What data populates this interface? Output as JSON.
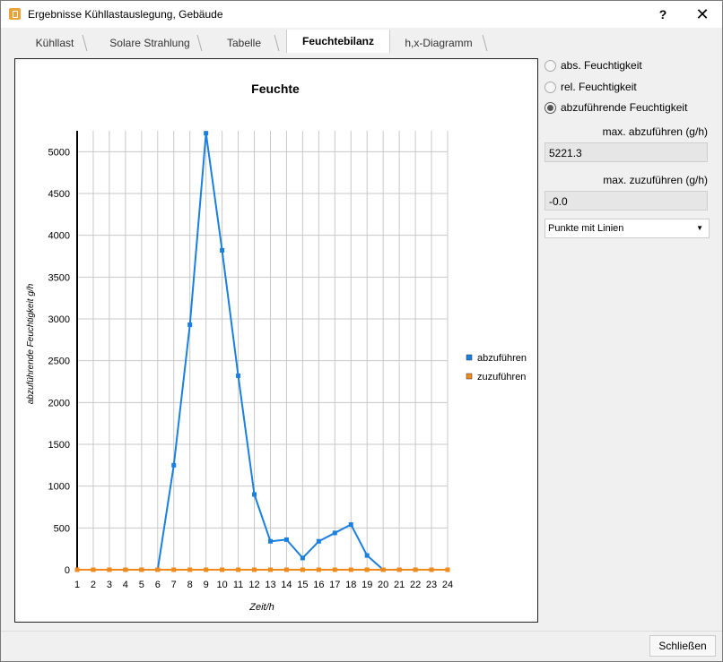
{
  "window": {
    "title": "Ergebnisse Kühllastauslegung, Gebäude",
    "help_label": "?",
    "close_label": "✕"
  },
  "tabs": [
    {
      "label": "Kühllast",
      "active": false
    },
    {
      "label": "Solare Strahlung",
      "active": false
    },
    {
      "label": "Tabelle",
      "active": false
    },
    {
      "label": "Feuchtebilanz",
      "active": true
    },
    {
      "label": "h,x-Diagramm",
      "active": false
    }
  ],
  "side_panel": {
    "radio_abs": "abs. Feuchtigkeit",
    "radio_rel": "rel. Feuchtigkeit",
    "radio_abzu": "abzuführende Feuchtigkeit",
    "max_abzufuehren_label": "max. abzuführen (g/h)",
    "max_abzufuehren_value": "5221.3",
    "max_zuzufuehren_label": "max. zuzuführen (g/h)",
    "max_zuzufuehren_value": "-0.0",
    "display_mode": "Punkte mit Linien"
  },
  "footer": {
    "close_button": "Schließen"
  },
  "chart_data": {
    "type": "line",
    "title": "Feuchte",
    "xlabel": "Zeit/h",
    "ylabel": "abzuführende Feuchtigkeit g/h",
    "x": [
      1,
      2,
      3,
      4,
      5,
      6,
      7,
      8,
      9,
      10,
      11,
      12,
      13,
      14,
      15,
      16,
      17,
      18,
      19,
      20,
      21,
      22,
      23,
      24
    ],
    "xlim": [
      1,
      24
    ],
    "ylim": [
      0,
      5250
    ],
    "yticks": [
      0,
      500,
      1000,
      1500,
      2000,
      2500,
      3000,
      3500,
      4000,
      4500,
      5000
    ],
    "grid": true,
    "legend_position": "right",
    "series": [
      {
        "name": "abzuführen",
        "color": "#1a7fe0",
        "values": [
          0,
          0,
          0,
          0,
          0,
          0,
          1250,
          2930,
          5221,
          3820,
          2320,
          900,
          340,
          360,
          140,
          340,
          440,
          540,
          170,
          0,
          0,
          0,
          0,
          0
        ]
      },
      {
        "name": "zuzuführen",
        "color": "#f08a1c",
        "values": [
          0,
          0,
          0,
          0,
          0,
          0,
          0,
          0,
          0,
          0,
          0,
          0,
          0,
          0,
          0,
          0,
          0,
          0,
          0,
          0,
          0,
          0,
          0,
          0
        ]
      }
    ]
  }
}
